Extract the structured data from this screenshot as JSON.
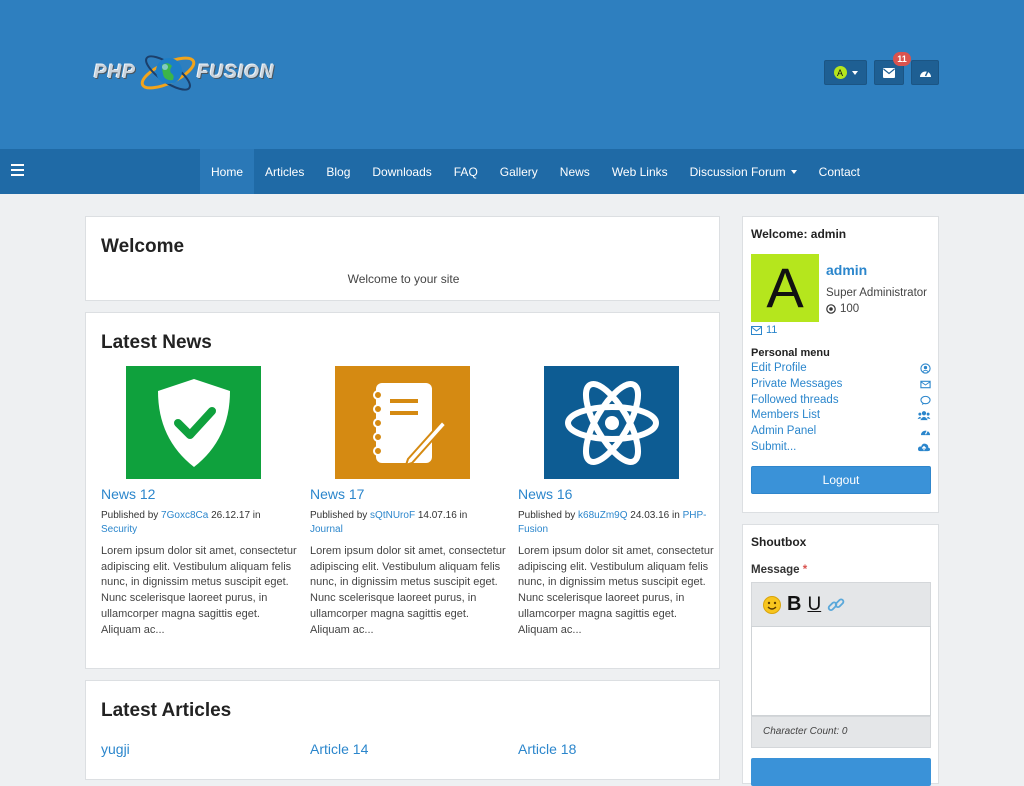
{
  "header": {
    "logo_php": "PHP",
    "logo_fusion": "FUSION",
    "user_initial": "A",
    "messages_count": "11"
  },
  "nav": {
    "items": [
      "Home",
      "Articles",
      "Blog",
      "Downloads",
      "FAQ",
      "Gallery",
      "News",
      "Web Links",
      "Discussion Forum",
      "Contact"
    ],
    "active": "Home"
  },
  "welcome": {
    "title": "Welcome",
    "text": "Welcome to your site"
  },
  "latest_news": {
    "title": "Latest News",
    "items": [
      {
        "title": "News 12",
        "published_by": "Published by",
        "author": "7Goxc8Ca",
        "date": "26.12.17",
        "in": "in",
        "category": "Security",
        "body": "Lorem ipsum dolor sit amet, consectetur adipiscing elit. Vestibulum aliquam felis nunc, in dignissim metus suscipit eget. Nunc scelerisque laoreet purus, in ullamcorper magna sagittis eget. Aliquam ac...",
        "image_icon": "shield-check-icon",
        "image_color": "#0fa13d"
      },
      {
        "title": "News 17",
        "published_by": "Published by",
        "author": "sQtNUroF",
        "date": "14.07.16",
        "in": "in",
        "category": "Journal",
        "body": "Lorem ipsum dolor sit amet, consectetur adipiscing elit. Vestibulum aliquam felis nunc, in dignissim metus suscipit eget. Nunc scelerisque laoreet purus, in ullamcorper magna sagittis eget. Aliquam ac...",
        "image_icon": "notebook-pencil-icon",
        "image_color": "#d58a12"
      },
      {
        "title": "News 16",
        "published_by": "Published by",
        "author": "k68uZm9Q",
        "date": "24.03.16",
        "in": "in",
        "category": "PHP-Fusion",
        "body": "Lorem ipsum dolor sit amet, consectetur adipiscing elit. Vestibulum aliquam felis nunc, in dignissim metus suscipit eget. Nunc scelerisque laoreet purus, in ullamcorper magna sagittis eget. Aliquam ac...",
        "image_icon": "atom-icon",
        "image_color": "#0d5c93"
      }
    ]
  },
  "latest_articles": {
    "title": "Latest Articles",
    "items": [
      {
        "title": "yugji"
      },
      {
        "title": "Article 14"
      },
      {
        "title": "Article 18"
      }
    ]
  },
  "user_panel": {
    "title": "Welcome: admin",
    "avatar_letter": "A",
    "avatar_color": "#b5e61d",
    "username": "admin",
    "role": "Super Administrator",
    "points": "100",
    "messages": "11",
    "personal_menu_title": "Personal menu",
    "menu": [
      {
        "label": "Edit Profile",
        "icon": "user-circle-icon"
      },
      {
        "label": "Private Messages",
        "icon": "envelope-icon"
      },
      {
        "label": "Followed threads",
        "icon": "comment-icon"
      },
      {
        "label": "Members List",
        "icon": "users-icon"
      },
      {
        "label": "Admin Panel",
        "icon": "dashboard-icon"
      },
      {
        "label": "Submit...",
        "icon": "cloud-upload-icon"
      }
    ],
    "logout_label": "Logout"
  },
  "shoutbox": {
    "title": "Shoutbox",
    "message_label": "Message",
    "required_mark": "*",
    "char_count": "Character Count: 0"
  },
  "colors": {
    "header_bg": "#2e7fbf",
    "nav_bg": "#1f6aa6",
    "link": "#2b86cc",
    "button": "#3a92d8"
  }
}
